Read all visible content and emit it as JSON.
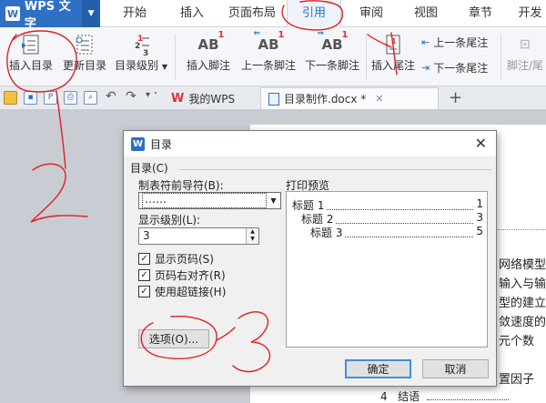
{
  "menubar": {
    "app_name": "WPS 文字",
    "tabs": [
      "开始",
      "插入",
      "页面布局",
      "引用",
      "审阅",
      "视图",
      "章节",
      "开发"
    ],
    "active_tab": "引用"
  },
  "ribbon": {
    "insert_toc": "插入目录",
    "update_toc": "更新目录",
    "toc_level": "目录级别",
    "insert_footnote": "插入脚注",
    "prev_footnote": "上一条脚注",
    "next_footnote": "下一条脚注",
    "insert_endnote": "插入尾注",
    "prev_endnote": "上一条尾注",
    "next_endnote": "下一条尾注",
    "footnote_endnote": "脚注/尾"
  },
  "doc_tabs": {
    "home": "我的WPS",
    "document": "目录制作.docx *"
  },
  "document": {
    "lines": [
      "网络模型",
      "输入与输",
      "型的建立",
      "敛速度的",
      "元个数",
      "置因子"
    ],
    "section_number": "4",
    "section_title": "结语"
  },
  "dialog": {
    "title": "目录",
    "group_label": "目录(C)",
    "leader_label": "制表符前导符(B):",
    "leader_value": "……",
    "level_label": "显示级别(L):",
    "level_value": "3",
    "show_page_numbers": "显示页码(S)",
    "right_align": "页码右对齐(R)",
    "use_hyperlinks": "使用超链接(H)",
    "options_button": "选项(O)...",
    "preview_label": "打印预览",
    "preview": [
      {
        "title": "标题 1",
        "page": "1"
      },
      {
        "title": "标题 2",
        "page": "3"
      },
      {
        "title": "标题 3",
        "page": "5"
      }
    ],
    "ok": "确定",
    "cancel": "取消"
  },
  "colors": {
    "brand": "#2f6fc4",
    "annotation": "#e02020"
  }
}
